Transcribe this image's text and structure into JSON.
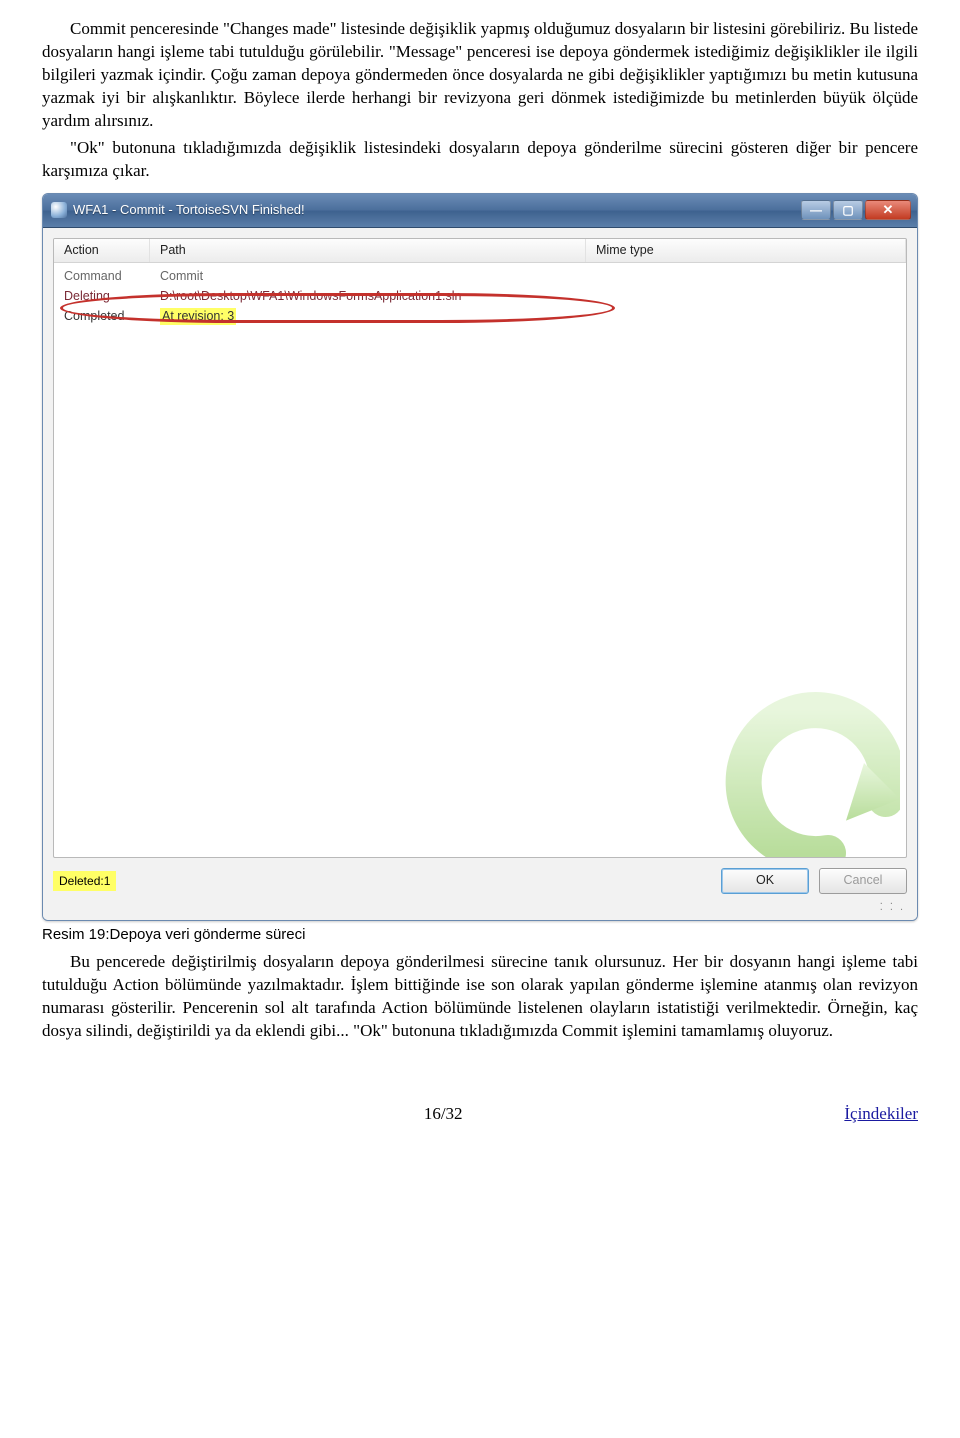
{
  "paragraphs": {
    "p1": "Commit penceresinde \"Changes made\" listesinde değişiklik yapmış olduğumuz dosyaların bir listesini görebiliriz. Bu listede dosyaların hangi işleme tabi tutulduğu görülebilir. \"Message\" penceresi ise depoya göndermek istediğimiz değişiklikler ile ilgili bilgileri yazmak içindir. Çoğu zaman depoya göndermeden önce dosyalarda ne gibi değişiklikler yaptığımızı bu metin kutusuna yazmak iyi bir alışkanlıktır. Böylece ilerde herhangi bir revizyona geri dönmek istediğimizde bu metinlerden büyük ölçüde yardım alırsınız.",
    "p2": "\"Ok\" butonuna tıkladığımızda değişiklik listesindeki dosyaların depoya gönderilme sürecini gösteren diğer bir pencere karşımıza çıkar.",
    "p3": "Bu pencerede değiştirilmiş dosyaların depoya gönderilmesi sürecine tanık olursunuz. Her bir dosyanın hangi işleme tabi tutulduğu Action bölümünde yazılmaktadır. İşlem bittiğinde ise son olarak yapılan gönderme işlemine atanmış olan revizyon numarası gösterilir. Pencerenin sol alt tarafında Action bölümünde listelenen olayların istatistiği verilmektedir. Örneğin, kaç dosya silindi, değiştirildi ya da eklendi gibi... \"Ok\" butonuna tıkladığımızda Commit işlemini tamamlamış oluyoruz."
  },
  "window": {
    "title": "WFA1 - Commit - TortoiseSVN Finished!",
    "columns": {
      "action": "Action",
      "path": "Path",
      "mime": "Mime type"
    },
    "rows": {
      "r1": {
        "action": "Command",
        "path": "Commit"
      },
      "r2": {
        "action": "Deleting",
        "path": "D:\\root\\Desktop\\WFA1\\WindowsFormsApplication1.sln"
      },
      "r3": {
        "action": "Completed",
        "path": "At revision: 3"
      }
    },
    "status": {
      "deleted": "Deleted:1"
    },
    "buttons": {
      "ok": "OK",
      "cancel": "Cancel"
    }
  },
  "caption": "Resim 19:Depoya veri gönderme süreci",
  "footer": {
    "page": "16/32",
    "toc": "İçindekiler"
  }
}
